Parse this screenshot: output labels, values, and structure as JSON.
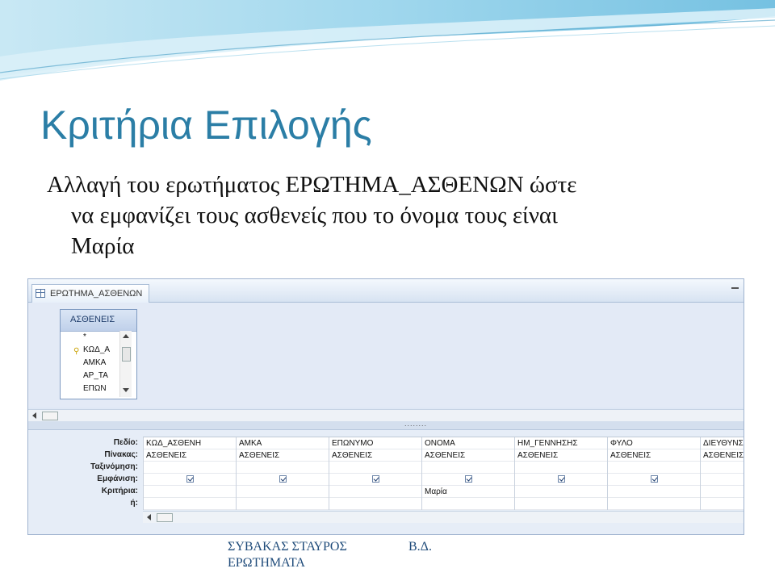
{
  "slide": {
    "title": "Κριτήρια Επιλογής",
    "body_line1": "Αλλαγή του ερωτήματος ΕΡΩΤΗΜΑ_ΑΣΘΕΝΩΝ ώστε",
    "body_line2": "να  εμφανίζει τους ασθενείς που το όνομα τους είναι",
    "body_line3": "Μαρία"
  },
  "window": {
    "tab_label": "ΕΡΩΤΗΜΑ_ΑΣΘΕΝΩΝ",
    "table": {
      "name": "ΑΣΘΕΝΕΙΣ",
      "fields": [
        "*",
        "ΚΩΔ_Α",
        "ΑΜΚΑ",
        "ΑΡ_ΤΑ",
        "ΕΠΩΝ"
      ]
    },
    "splitter_marks": "........",
    "grid": {
      "row_labels": [
        "Πεδίο:",
        "Πίνακας:",
        "Ταξινόμηση:",
        "Εμφάνιση:",
        "Κριτήρια:",
        "ή:"
      ],
      "columns": [
        {
          "field": "ΚΩΔ_ΑΣΘΕΝΗ",
          "table": "ΑΣΘΕΝΕΙΣ",
          "sort": "",
          "show": true,
          "criteria": "",
          "or": ""
        },
        {
          "field": "ΑΜΚΑ",
          "table": "ΑΣΘΕΝΕΙΣ",
          "sort": "",
          "show": true,
          "criteria": "",
          "or": ""
        },
        {
          "field": "ΕΠΩΝΥΜΟ",
          "table": "ΑΣΘΕΝΕΙΣ",
          "sort": "",
          "show": true,
          "criteria": "",
          "or": ""
        },
        {
          "field": "ΟΝΟΜΑ",
          "table": "ΑΣΘΕΝΕΙΣ",
          "sort": "",
          "show": true,
          "criteria": "Μαρία",
          "or": ""
        },
        {
          "field": "ΗΜ_ΓΕΝΝΗΣΗΣ",
          "table": "ΑΣΘΕΝΕΙΣ",
          "sort": "",
          "show": true,
          "criteria": "",
          "or": ""
        },
        {
          "field": "ΦΥΛΟ",
          "table": "ΑΣΘΕΝΕΙΣ",
          "sort": "",
          "show": true,
          "criteria": "",
          "or": ""
        },
        {
          "field": "ΔΙΕΥΘΥΝΣΗ",
          "table": "ΑΣΘΕΝΕΙΣ",
          "sort": "",
          "show": true,
          "criteria": "",
          "or": ""
        }
      ]
    }
  },
  "footer": {
    "author": "ΣΥΒΑΚΑΣ ΣΤΑΥΡΟΣ",
    "topic": "ΕΡΩΤΗΜΑΤΑ",
    "right": "Β.Δ."
  },
  "colors": {
    "title": "#2b7ea6",
    "swoosh": "#7ec7e3"
  }
}
